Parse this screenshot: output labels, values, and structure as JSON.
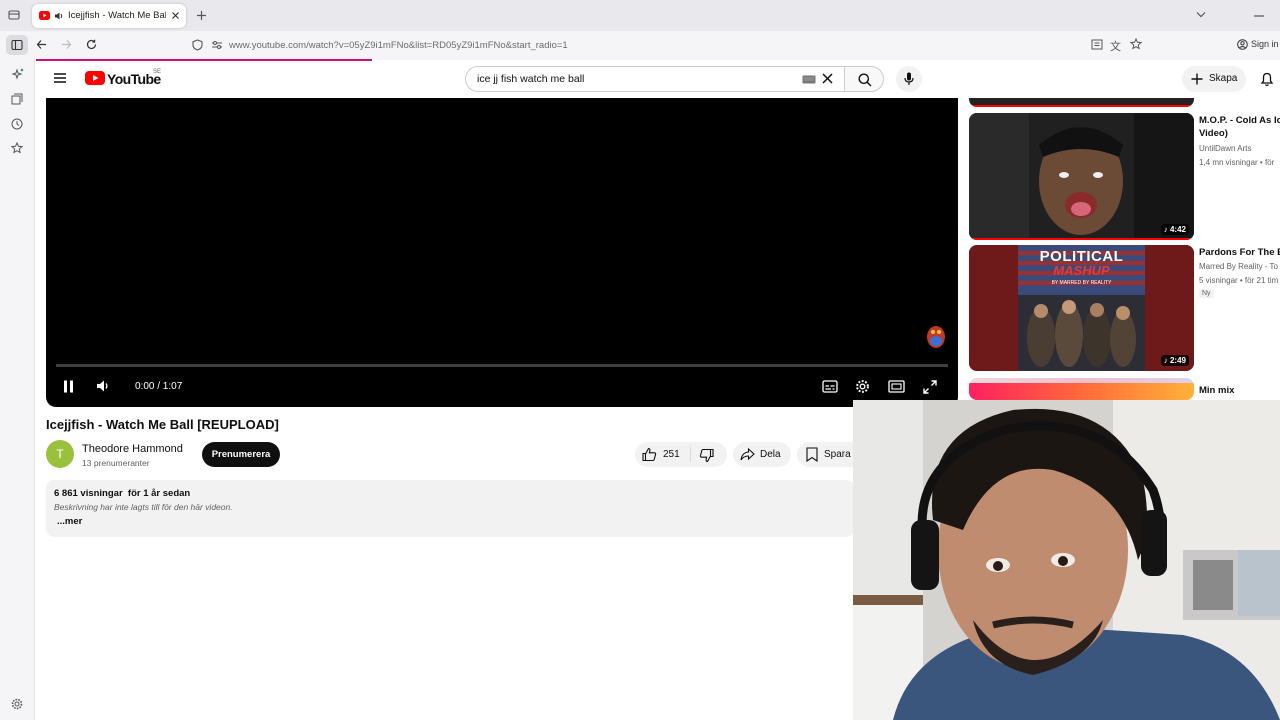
{
  "browser": {
    "tab_title": "Icejjfish - Watch Me Ball [R",
    "url": "www.youtube.com/watch?v=05yZ9i1mFNo&list=RD05yZ9i1mFNo&start_radio=1",
    "sign_in": "Sign in"
  },
  "header": {
    "logo": "YouTube",
    "country": "SE",
    "search_value": "ice jj fish watch me ball",
    "create_label": "Skapa"
  },
  "player": {
    "time": "0:00 / 1:07"
  },
  "video": {
    "title": "Icejjfish - Watch Me Ball [REUPLOAD]",
    "channel_initial": "T",
    "channel": "Theodore Hammond",
    "subscribers": "13 prenumeranter",
    "subscribe_label": "Prenumerera",
    "likes": "251",
    "share_label": "Dela",
    "save_label": "Spara",
    "views": "6 861 visningar  för 1 år sedan",
    "description": "Beskrivning har inte lagts till för den här videon.",
    "more_label": "...mer"
  },
  "recommendations": [
    {
      "title_line1": "M.O.P. - Cold As Ic",
      "title_line2": "Video)",
      "channel": "UntilDawn Arts",
      "meta": "1,4 mn visningar • för",
      "duration": "4:42"
    },
    {
      "title_line1": "Pardons For The E",
      "channel": "Marred By Reality - To",
      "meta": "5 visningar • för 21 tim",
      "badge": "Ny",
      "duration": "2:49",
      "thumb_title": "POLITICAL",
      "thumb_subtitle": "MASHUP",
      "thumb_by": "BY MARRED BY REALITY"
    },
    {
      "title_line1": "Min mix"
    }
  ],
  "colors": {
    "accent": "#ff0000",
    "tab_progress": "#d30f73"
  }
}
